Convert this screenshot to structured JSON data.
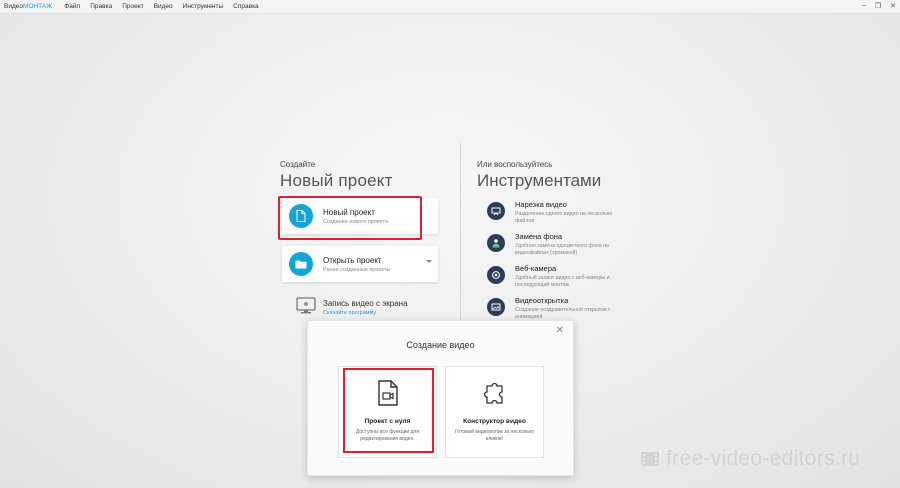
{
  "app": {
    "brand_part1": "Видео",
    "brand_part2": "МОНТАЖ",
    "menu": [
      "Файл",
      "Правка",
      "Проект",
      "Видео",
      "Инструменты",
      "Справка"
    ],
    "window_controls": [
      "–",
      "❐",
      "✕"
    ]
  },
  "left": {
    "create_small": "Создайте",
    "create_big": "Новый проект",
    "new_project": {
      "title": "Новый проект",
      "subtitle": "Создание нового проекта"
    },
    "open_project": {
      "title": "Открыть проект",
      "subtitle": "Ранее созданные проекты"
    },
    "record": {
      "title": "Запись видео с экрана",
      "link": "Скачайте программу"
    }
  },
  "right": {
    "small": "Или воспользуйтесь",
    "big": "Инструментами",
    "tools": [
      {
        "title": "Нарезка видео",
        "desc": "Разделение одного видео на несколько файлов",
        "icon": "scissors-icon"
      },
      {
        "title": "Замена фона",
        "desc": "Удобная замена однцветного фона на видеофайлах (хромакей)",
        "icon": "chromakey-icon"
      },
      {
        "title": "Веб-камера",
        "desc": "Удобный захват видео с веб-камеры и последующий монтаж",
        "icon": "webcam-icon"
      },
      {
        "title": "Видеооткрытка",
        "desc": "Создание поздравительной открытки с анимацией",
        "icon": "postcard-icon"
      }
    ]
  },
  "dialog": {
    "title": "Создание видео",
    "close": "✕",
    "scratch": {
      "title": "Проект с нуля",
      "desc": "Доступны все функции для редактирования видео."
    },
    "builder": {
      "title": "Конструктор видео",
      "desc": "Готовый видеоролик за несколько кликов!"
    }
  },
  "watermark": "free-video-editors.ru",
  "colors": {
    "accent": "#12a6d7",
    "highlight": "#e0202a",
    "tool_icon": "#2e3d57"
  }
}
